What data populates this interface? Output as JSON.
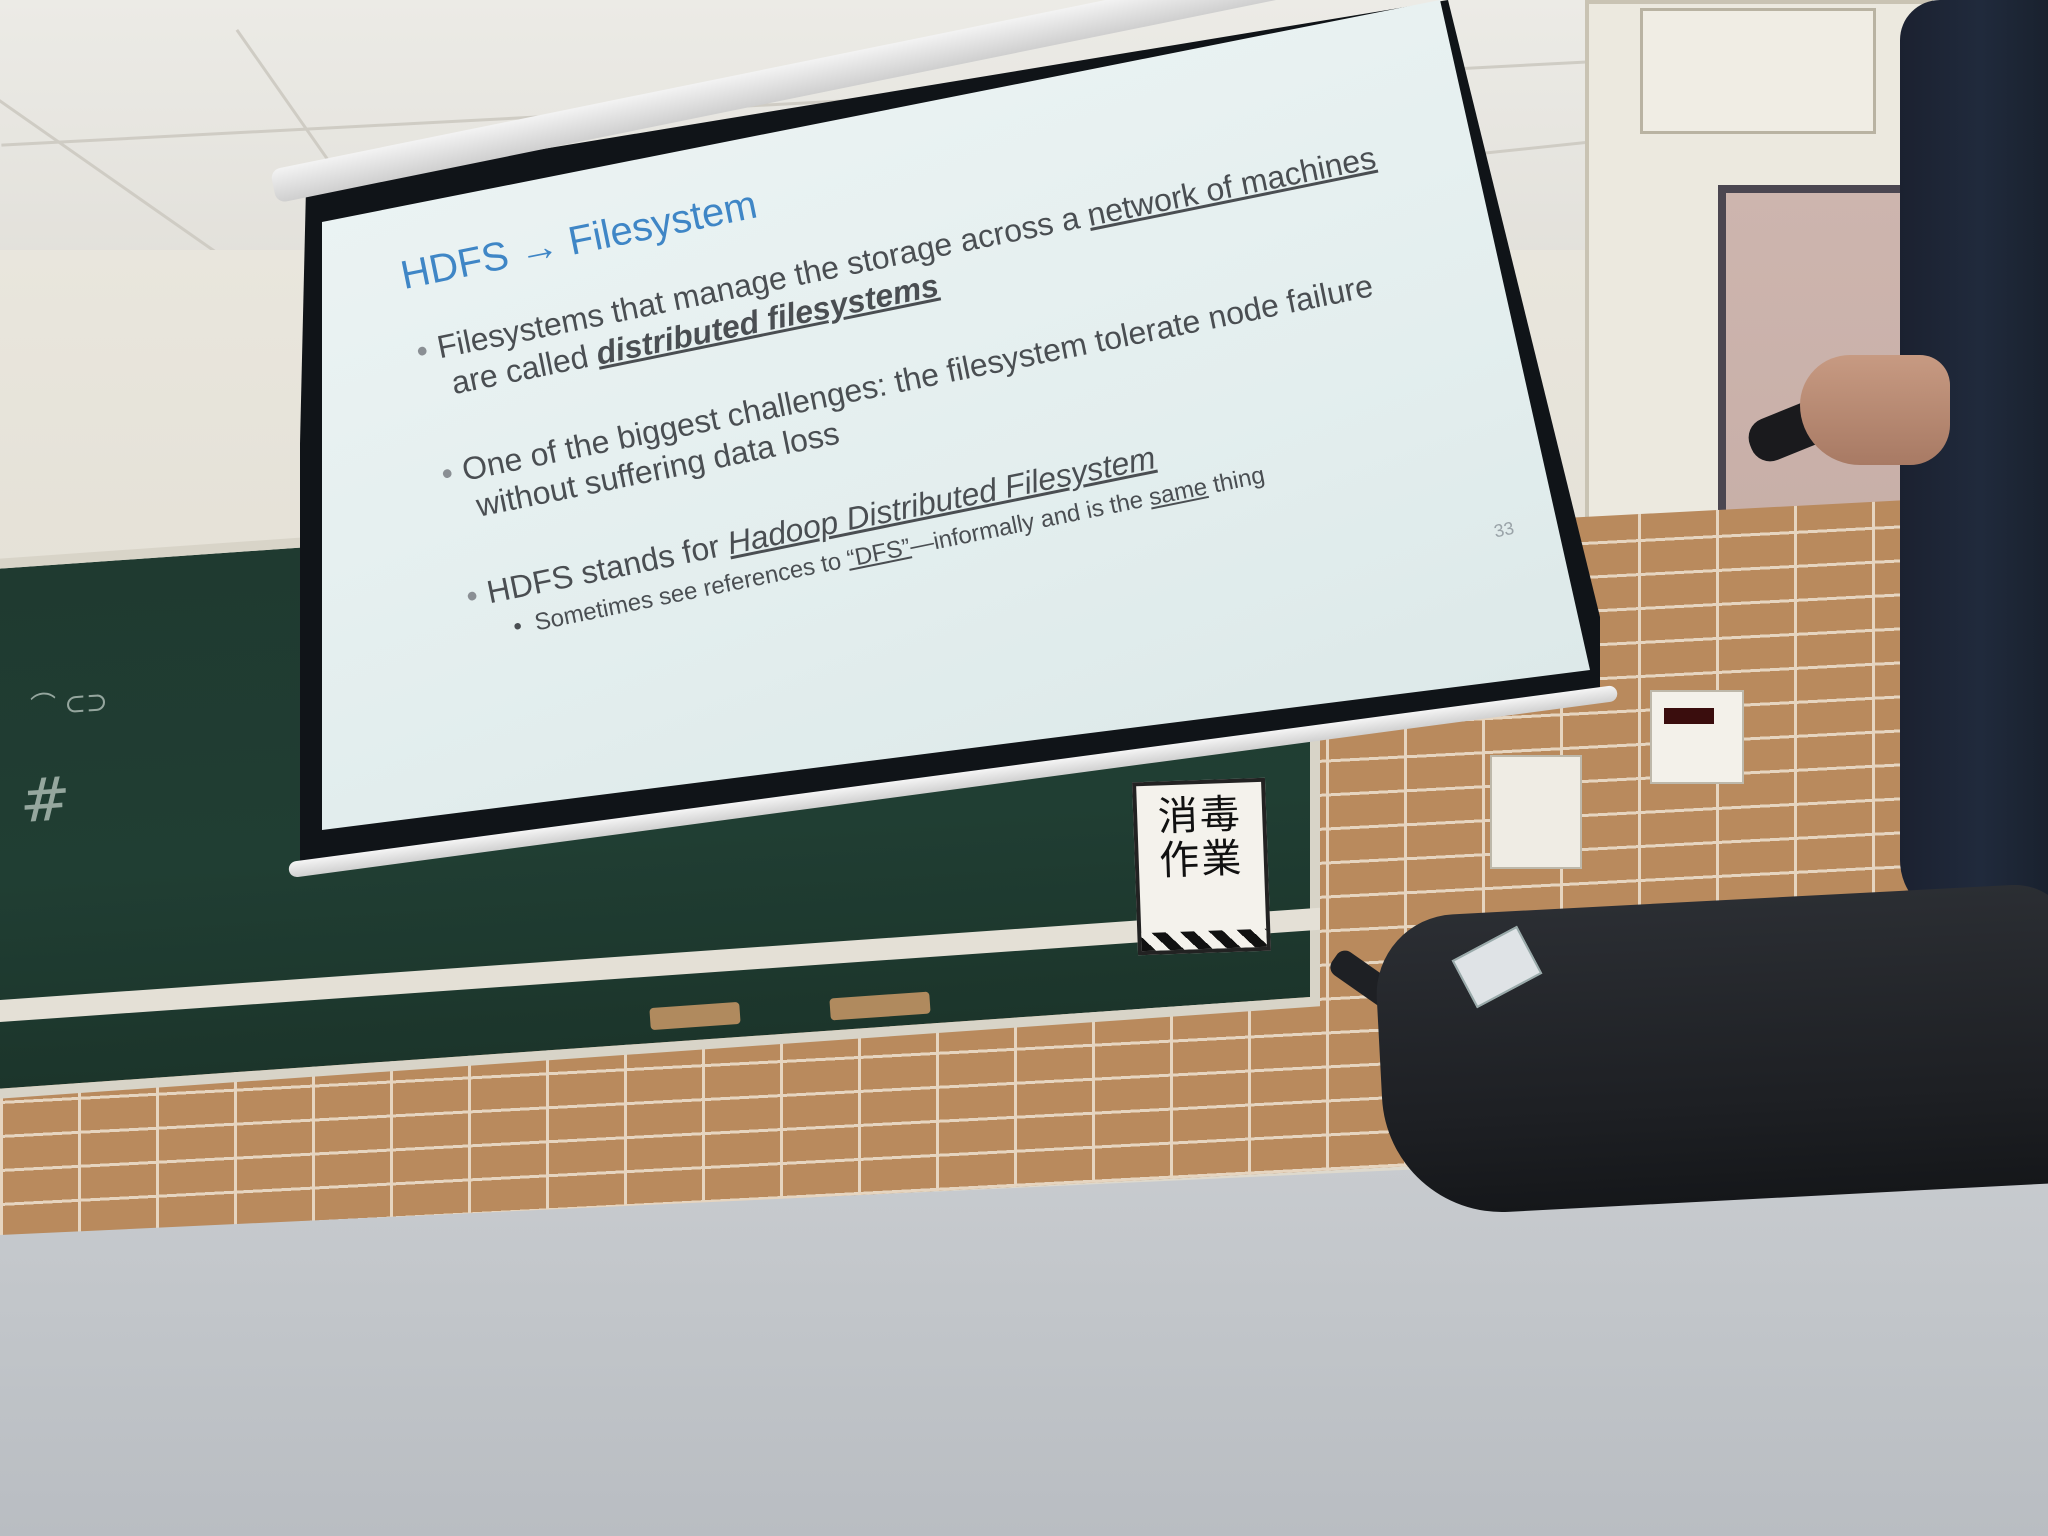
{
  "slide": {
    "title": "HDFS → Filesystem",
    "bullets": [
      {
        "line1_before": "Filesystems that manage the storage across a ",
        "line1_link": "network of machines",
        "line2_before": "are called ",
        "line2_emph": "distributed filesystems"
      },
      {
        "line1": "One of the biggest challenges:  the filesystem tolerate node failure",
        "line2": "without suffering data loss"
      },
      {
        "line1_before": "HDFS stands for ",
        "line1_emph": "Hadoop Distributed Filesystem",
        "sub_before": "Sometimes see references to ",
        "sub_quote": "“DFS”",
        "sub_middle": "—informally and is the ",
        "sub_same": "same",
        "sub_after": " thing"
      }
    ],
    "slide_number": "33"
  },
  "notice": {
    "text": "消毒作業"
  },
  "colors": {
    "slide_title": "#3f86c6",
    "slide_text": "#4a4e52",
    "chalkboard": "#1f3a30",
    "brick": "#b98a5d"
  }
}
